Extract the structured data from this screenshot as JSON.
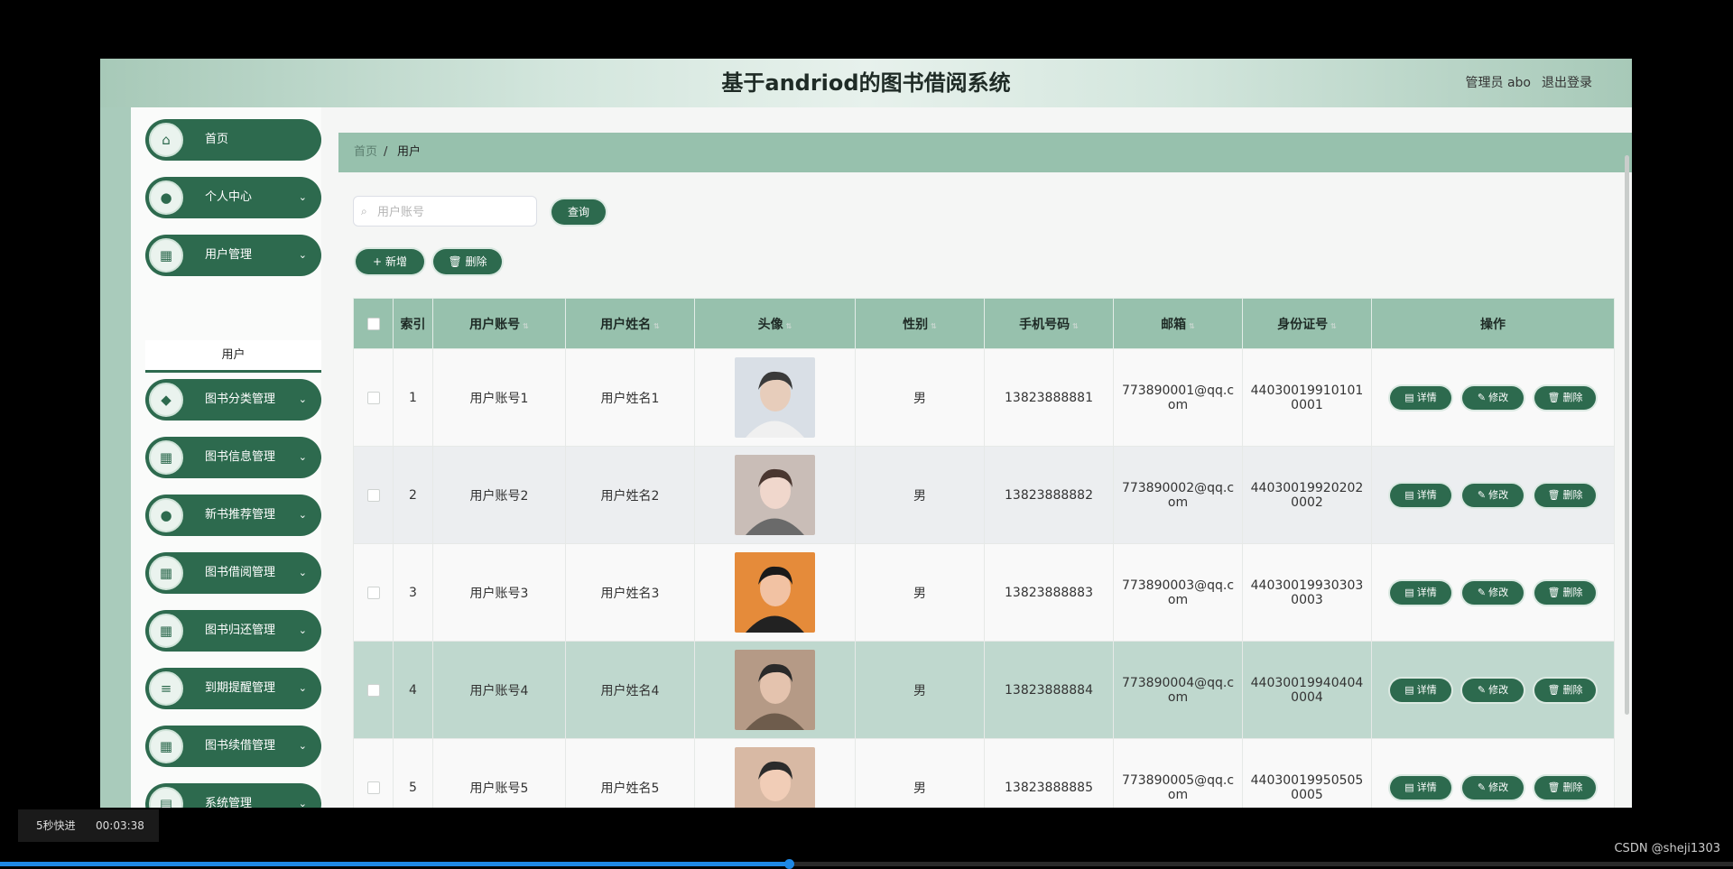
{
  "header": {
    "title": "基于andriod的图书借阅系统",
    "user": "管理员 abo",
    "logout": "退出登录"
  },
  "sidebar": {
    "items": [
      {
        "label": "首页",
        "icon": "home-icon",
        "glyph": "⌂",
        "chevron": false
      },
      {
        "label": "个人中心",
        "icon": "person-icon",
        "glyph": "●",
        "chevron": true
      },
      {
        "label": "用户管理",
        "icon": "grid-icon",
        "glyph": "▦",
        "chevron": true
      },
      {
        "label": "图书分类管理",
        "icon": "tag-icon",
        "glyph": "◆",
        "chevron": true
      },
      {
        "label": "图书信息管理",
        "icon": "grid-icon",
        "glyph": "▦",
        "chevron": true
      },
      {
        "label": "新书推荐管理",
        "icon": "person-icon",
        "glyph": "●",
        "chevron": true
      },
      {
        "label": "图书借阅管理",
        "icon": "grid-icon",
        "glyph": "▦",
        "chevron": true
      },
      {
        "label": "图书归还管理",
        "icon": "grid-icon",
        "glyph": "▦",
        "chevron": true
      },
      {
        "label": "到期提醒管理",
        "icon": "list-icon",
        "glyph": "≡",
        "chevron": true
      },
      {
        "label": "图书续借管理",
        "icon": "grid-icon",
        "glyph": "▦",
        "chevron": true
      },
      {
        "label": "系统管理",
        "icon": "clipboard-icon",
        "glyph": "▤",
        "chevron": true
      }
    ],
    "subitem": "用户",
    "chevron_glyph": "⌄"
  },
  "breadcrumb": {
    "home": "首页",
    "separator": "/",
    "current": "用户"
  },
  "search": {
    "placeholder": "用户账号",
    "value": "",
    "icon": "search-icon",
    "button": "查询"
  },
  "actions": {
    "add": "新增",
    "delete": "删除",
    "add_icon": "+",
    "delete_icon": "🗑"
  },
  "table": {
    "columns": [
      "索引",
      "用户账号",
      "用户姓名",
      "头像",
      "性别",
      "手机号码",
      "邮箱",
      "身份证号",
      "操作"
    ],
    "sortable": [
      false,
      true,
      true,
      true,
      true,
      true,
      true,
      true,
      false
    ],
    "rows": [
      {
        "index": "1",
        "account": "用户账号1",
        "name": "用户姓名1",
        "gender": "男",
        "phone": "13823888881",
        "email": "773890001@qq.com",
        "idcard": "440300199101010001"
      },
      {
        "index": "2",
        "account": "用户账号2",
        "name": "用户姓名2",
        "gender": "男",
        "phone": "13823888882",
        "email": "773890002@qq.com",
        "idcard": "440300199202020002"
      },
      {
        "index": "3",
        "account": "用户账号3",
        "name": "用户姓名3",
        "gender": "男",
        "phone": "13823888883",
        "email": "773890003@qq.com",
        "idcard": "440300199303030003"
      },
      {
        "index": "4",
        "account": "用户账号4",
        "name": "用户姓名4",
        "gender": "男",
        "phone": "13823888884",
        "email": "773890004@qq.com",
        "idcard": "440300199404040004"
      },
      {
        "index": "5",
        "account": "用户账号5",
        "name": "用户姓名5",
        "gender": "男",
        "phone": "13823888885",
        "email": "773890005@qq.com",
        "idcard": "440300199505050005"
      }
    ],
    "row_actions": [
      "详情",
      "修改",
      "删除"
    ],
    "row_action_icons": [
      "▤",
      "✎",
      "🗑"
    ],
    "highlighted_row": 4
  },
  "player": {
    "speed_label": "5秒快进",
    "time": "00:03:38",
    "progress": 0.455
  },
  "watermark": "CSDN @sheji1303",
  "colors": {
    "primary": "#2d6a4e",
    "header_green": "#97c1ad",
    "highlight_row": "#bfd8ce"
  }
}
